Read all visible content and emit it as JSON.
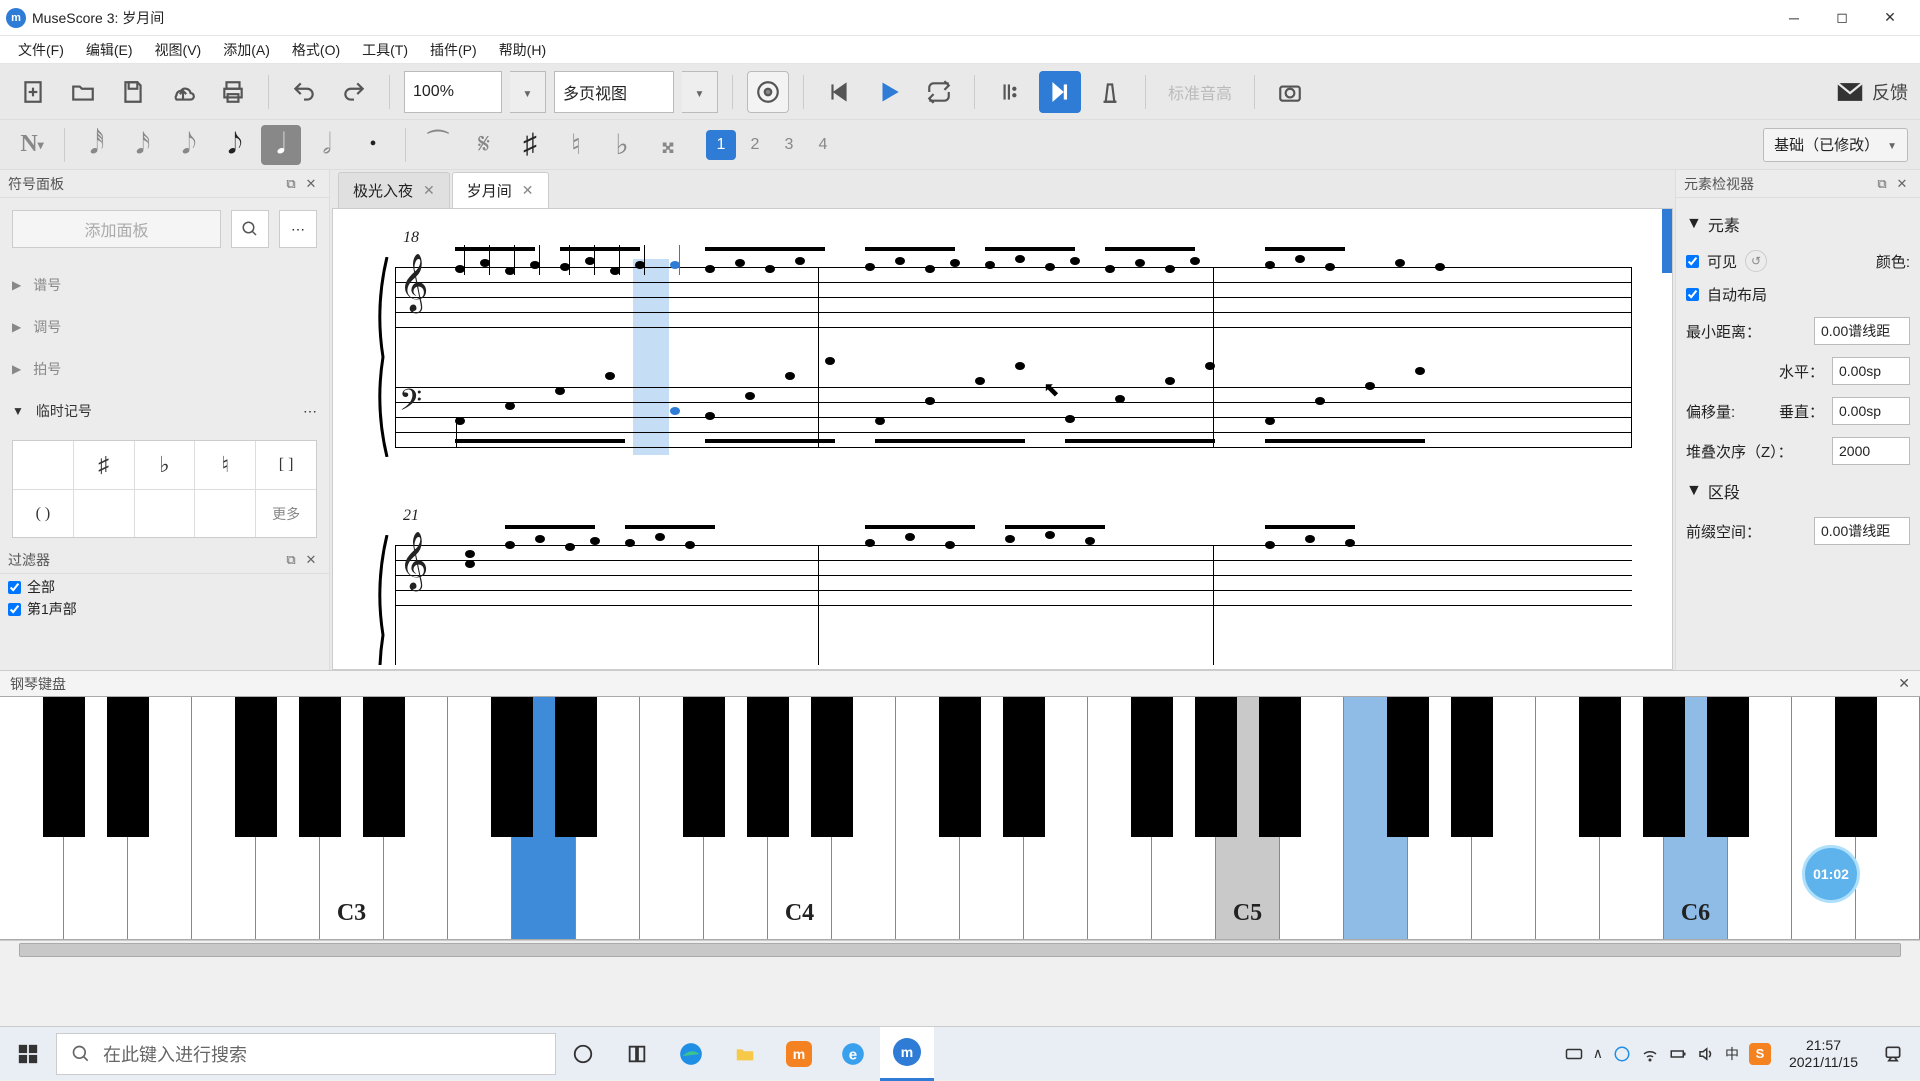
{
  "window": {
    "title": "MuseScore 3: 岁月间"
  },
  "menu": [
    "文件(F)",
    "编辑(E)",
    "视图(V)",
    "添加(A)",
    "格式(O)",
    "工具(T)",
    "插件(P)",
    "帮助(H)"
  ],
  "toolbar1": {
    "zoom": "100%",
    "view_mode": "多页视图",
    "pitch_label": "标准音高",
    "feedback": "反馈"
  },
  "toolbar2": {
    "voices": [
      "1",
      "2",
      "3",
      "4"
    ],
    "active_voice": 0,
    "workspace": "基础（已修改）"
  },
  "palette": {
    "title": "符号面板",
    "add_label": "添加面板",
    "sections": [
      "谱号",
      "调号",
      "拍号",
      "临时记号"
    ],
    "acc_row1": [
      "",
      "♯",
      "♭",
      "♮",
      "[ ]"
    ],
    "acc_row2": [
      "( )",
      "",
      "",
      "",
      "更多"
    ]
  },
  "filter": {
    "title": "过滤器",
    "items": [
      "全部",
      "第1声部"
    ]
  },
  "tabs": [
    {
      "label": "极光入夜",
      "active": false
    },
    {
      "label": "岁月间",
      "active": true
    }
  ],
  "score": {
    "system1_start": "18",
    "system2_start": "21"
  },
  "inspector": {
    "title": "元素检视器",
    "sect_element": "元素",
    "visible": "可见",
    "color_label": "颜色:",
    "autoplace": "自动布局",
    "min_dist": "最小距离：",
    "min_dist_val": "0.00谱线距",
    "offset": "偏移量:",
    "h_label": "水平：",
    "h_val": "0.00sp",
    "v_label": "垂直：",
    "v_val": "0.00sp",
    "stack": "堆叠次序（Z）：",
    "stack_val": "2000",
    "sect_segment": "区段",
    "leading": "前缀空间：",
    "leading_val": "0.00谱线距"
  },
  "piano": {
    "title": "钢琴键盘",
    "labels": {
      "C3": "C3",
      "C4": "C4",
      "C5": "C5",
      "C6": "C6"
    },
    "timer": "01:02"
  },
  "taskbar": {
    "search_placeholder": "在此键入进行搜索",
    "time": "21:57",
    "date": "2021/11/15"
  }
}
